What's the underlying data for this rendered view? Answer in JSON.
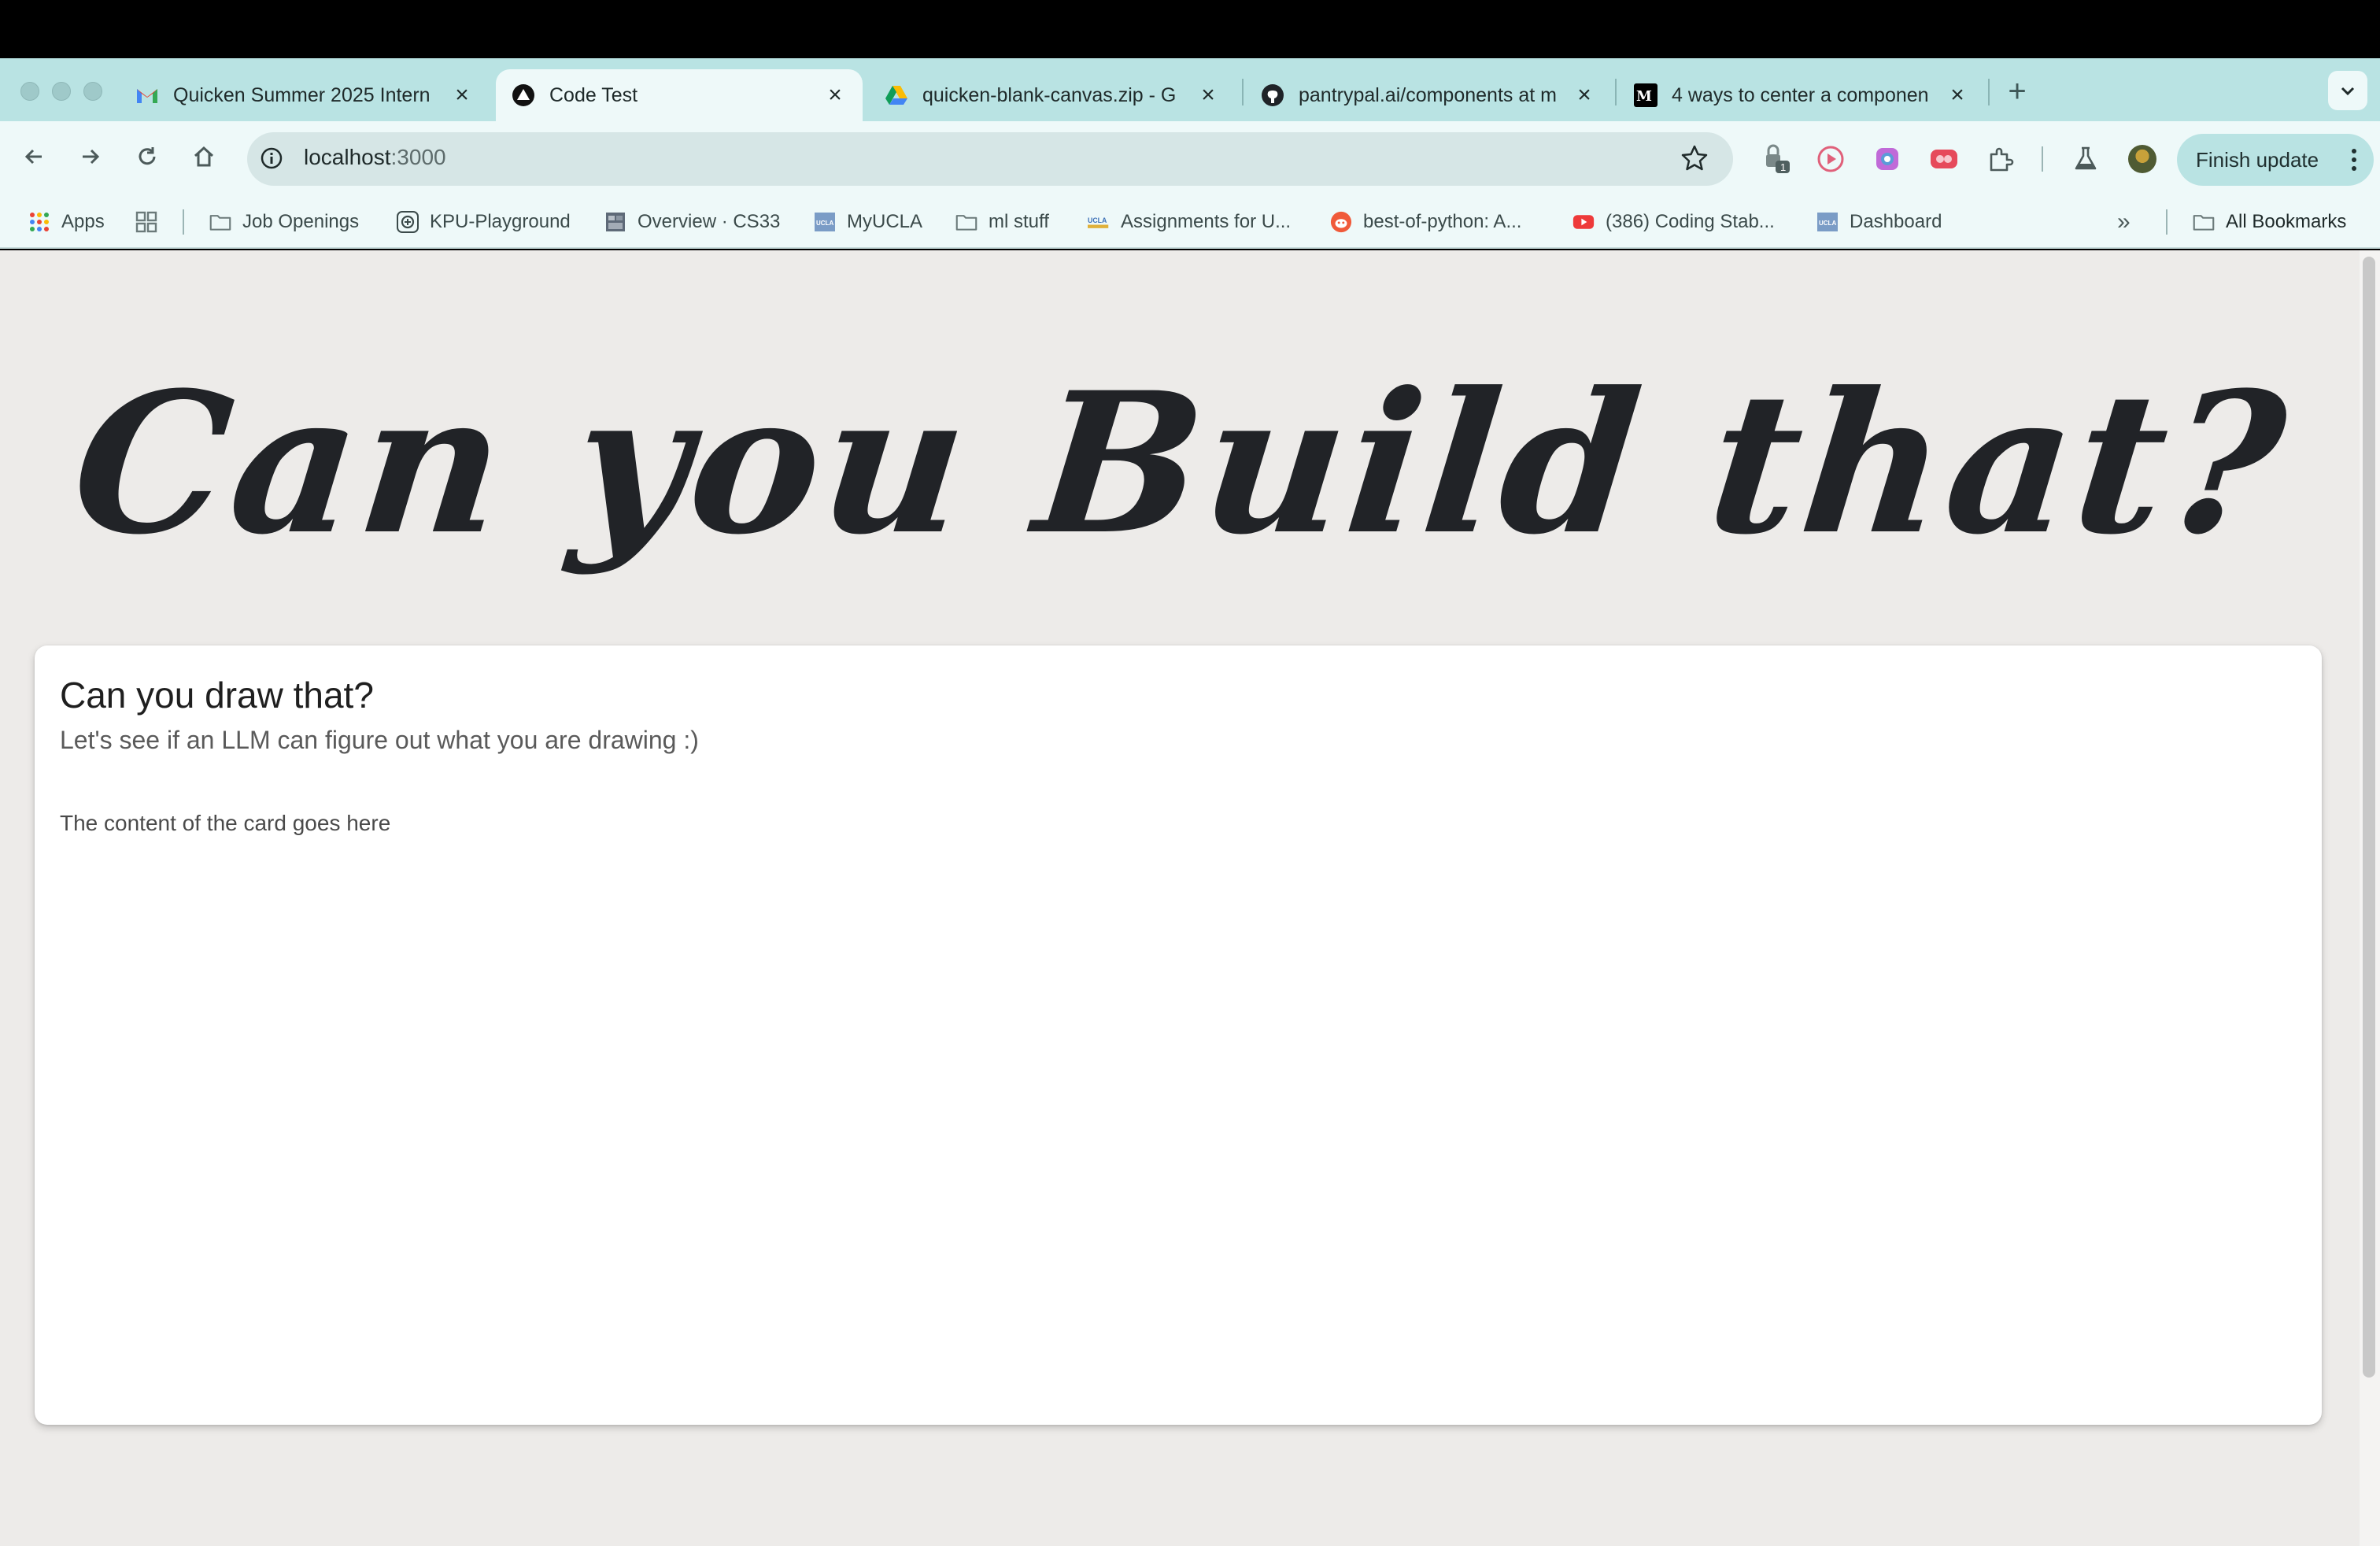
{
  "browser": {
    "tabs": [
      {
        "title": "Quicken Summer 2025 Intern",
        "icon": "gmail-icon"
      },
      {
        "title": "Code Test",
        "icon": "triangle-logo-icon"
      },
      {
        "title": "quicken-blank-canvas.zip - G",
        "icon": "google-drive-icon"
      },
      {
        "title": "pantrypal.ai/components at m",
        "icon": "github-icon"
      },
      {
        "title": "4 ways to center a componen",
        "icon": "medium-icon"
      }
    ],
    "active_tab_index": 1,
    "new_tab_label": "+",
    "address": {
      "host": "localhost",
      "port": ":3000"
    },
    "extension_badge": "1",
    "finish_update_label": "Finish update"
  },
  "bookmarks": [
    {
      "label": "Apps",
      "icon": "apps-grid-icon"
    },
    {
      "label": "",
      "icon": "tab-groups-icon"
    },
    {
      "label": "Job Openings",
      "icon": "folder-icon"
    },
    {
      "label": "KPU-Playground",
      "icon": "openai-icon"
    },
    {
      "label": "Overview · CS33",
      "icon": "page-icon"
    },
    {
      "label": "MyUCLA",
      "icon": "ucla-icon"
    },
    {
      "label": "ml stuff",
      "icon": "folder-icon"
    },
    {
      "label": "Assignments for U...",
      "icon": "ucla-icon"
    },
    {
      "label": "best-of-python: A...",
      "icon": "reddit-icon"
    },
    {
      "label": "(386) Coding Stab...",
      "icon": "youtube-icon"
    },
    {
      "label": "Dashboard",
      "icon": "ucla-icon"
    }
  ],
  "bookmarks_overflow": "»",
  "all_bookmarks_label": "All Bookmarks",
  "page": {
    "hero_title": "Can you Build that?",
    "card": {
      "title": "Can you draw that?",
      "subtitle": "Let's see if an LLM can figure out what you are drawing :)",
      "content": "The content of the card goes here"
    }
  },
  "colors": {
    "tabstrip": "#b9e3e3",
    "toolbar": "#eef9f9",
    "page_background": "#edebe9",
    "card_background": "#ffffff",
    "hero_text": "#212327"
  }
}
